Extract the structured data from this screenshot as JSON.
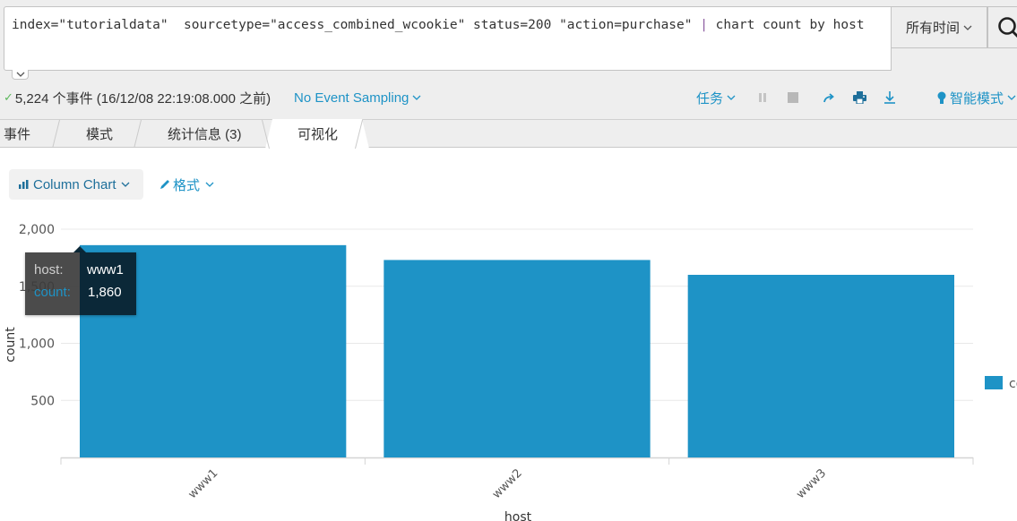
{
  "search": {
    "query_part1": "index=\"tutorialdata\"  sourcetype=\"access_combined_wcookie\" status=200 \"action=purchase\" ",
    "pipe": "|",
    "query_part2": " chart count by host",
    "time_range": "所有时间",
    "search_icon": "search-icon"
  },
  "status": {
    "check_icon": "✓",
    "summary": "5,224 个事件 (16/12/08 22:19:08.000 之前)",
    "sampling": "No Event Sampling",
    "job_menu": "任务",
    "smart_mode": "智能模式"
  },
  "tabs": [
    {
      "label": "事件",
      "active": false
    },
    {
      "label": "模式",
      "active": false
    },
    {
      "label": "统计信息 (3)",
      "active": false
    },
    {
      "label": "可视化",
      "active": true
    }
  ],
  "viz": {
    "chart_type_label": "Column Chart",
    "format_label": "格式"
  },
  "tooltip": {
    "host_key": "host:",
    "host_value": "www1",
    "count_key": "count:",
    "count_value": "1,860"
  },
  "colors": {
    "bar": "#1e93c6",
    "accent": "#1e93c6"
  },
  "chart_data": {
    "type": "bar",
    "title": "",
    "xlabel": "host",
    "ylabel": "count",
    "categories": [
      "www1",
      "www2",
      "www3"
    ],
    "series": [
      {
        "name": "count",
        "values": [
          1860,
          1730,
          1600
        ]
      }
    ],
    "ylim": [
      0,
      2000
    ],
    "yticks": [
      500,
      1000,
      1500,
      2000
    ],
    "ytick_labels": [
      "500",
      "1,000",
      "1,500",
      "2,000"
    ],
    "grid": true,
    "legend": {
      "position": "right",
      "entries": [
        "count"
      ],
      "visible_text": "co"
    }
  }
}
